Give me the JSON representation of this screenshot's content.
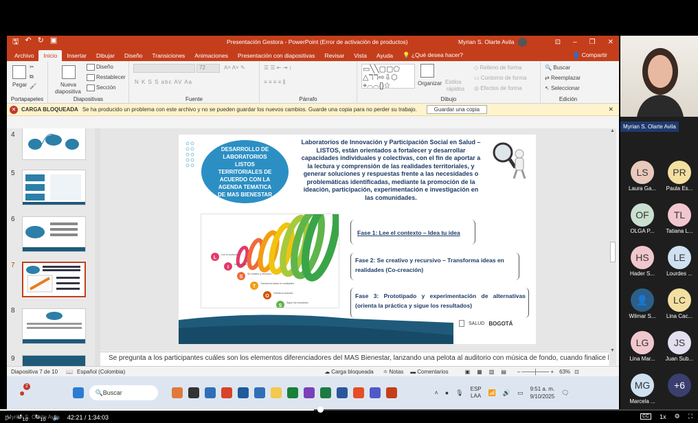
{
  "window": {
    "title": "Presentación Gestora - PowerPoint (Error de activación de productos)",
    "user": "Myrian S. Olarte Avila"
  },
  "tabs": [
    "Archivo",
    "Inicio",
    "Insertar",
    "Dibujar",
    "Diseño",
    "Transiciones",
    "Animaciones",
    "Presentación con diapositivas",
    "Revisar",
    "Vista",
    "Ayuda"
  ],
  "tellme": "¿Qué desea hacer?",
  "share": "Compartir",
  "ribbon": {
    "groups": [
      "Portapapeles",
      "Diapositivas",
      "Fuente",
      "Párrafo",
      "Dibujo",
      "Edición"
    ],
    "pegar": "Pegar",
    "nueva": "Nueva",
    "diapositiva": "diapositiva",
    "diseno": "Diseño",
    "restablecer": "Restablecer",
    "seccion": "Sección",
    "fontsize": "72",
    "fontbtns": "N  K  S  S  abc  AV  Aa",
    "organizar": "Organizar",
    "estilos": "Estilos",
    "rapidos": "rápidos",
    "relleno": "Relleno de forma",
    "contorno": "Contorno de forma",
    "efectos": "Efectos de forma",
    "buscar": "Buscar",
    "reemplazar": "Reemplazar",
    "seleccionar": "Seleccionar"
  },
  "infobar": {
    "title": "CARGA BLOQUEADA",
    "message": "Se ha producido un problema con este archivo y no se pueden guardar los nuevos cambios. Guarde una copia para no perder su trabajo.",
    "button": "Guardar una copia"
  },
  "thumbnails": [
    "4",
    "5",
    "6",
    "7",
    "8",
    "9"
  ],
  "slide": {
    "bubble": "DESARROLLO DE LABORATORIOS LISTOS TERRITORIALES DE ACUERDO CON LA AGENDA TEMATICA DE MAS BIENESTAR",
    "body": "Laboratorios de Innovación y Participación Social en Salud – LISTOS, están orientados a fortalecer y desarrollar capacidades individuales y colectivas, con el fin de aportar a la lectura y comprensión de las realidades territoriales, y generar soluciones y respuestas frente a las necesidades o problemáticas identificadas, mediante la promoción de la ideación, participación, experimentación e investigación en las comunidades.",
    "fase1": "Fase 1: Lee el contexto – Idea tu idea",
    "fase2": "Fase 2: Se creativo y recursivo – Transforma ideas en realidades (Co-creación)",
    "fase3": "Fase 3: Prototipado y experimentación de alternativas (orienta la práctica y sigue los resultados)",
    "spiral_letters": [
      "L",
      "I",
      "S",
      "T",
      "O",
      "S"
    ],
    "spiral_labels": [
      "Lee el contexto",
      "Idea tu idea",
      "Se creativo y recursivo",
      "Transforma ideas en realidades",
      "Orienta la práctica",
      "Sigue los resultados"
    ],
    "footer_logo": "BOGOTÁ",
    "footer_salud": "SALUD"
  },
  "notes": "Se pregunta a los participantes cuáles son los elementos diferenciadores del MAS Bienestar, lanzando una pelota al auditorio con música de fondo, cuando finalice la",
  "status": {
    "slide": "Diapositiva 7 de 10",
    "lang": "Español (Colombia)",
    "blocked": "Carga bloqueada",
    "notes": "Notas",
    "comments": "Comentarios",
    "zoom": "63%"
  },
  "taskbar": {
    "search": "Buscar",
    "lang1": "ESP",
    "lang2": "LAA",
    "time": "9:51 a. m.",
    "date": "9/10/2025",
    "badge": "2"
  },
  "participants": [
    {
      "initials": "LS",
      "name": "Laura Ga...",
      "color": "#e8c9bc"
    },
    {
      "initials": "PR",
      "name": "Paula Es...",
      "color": "#f3dfa0"
    },
    {
      "initials": "OF",
      "name": "OLGA P...",
      "color": "#c9dfcf"
    },
    {
      "initials": "TL",
      "name": "Tatiana L...",
      "color": "#f2c6cf"
    },
    {
      "initials": "HS",
      "name": "Hader S...",
      "color": "#f0c7cd"
    },
    {
      "initials": "LE",
      "name": "Lourdes ...",
      "color": "#cfe0f0"
    },
    {
      "initials": "",
      "name": "Wilmar S...",
      "color": "#2b5f8a"
    },
    {
      "initials": "LC",
      "name": "Lina Cac...",
      "color": "#f3dfa0"
    },
    {
      "initials": "LG",
      "name": "Lina Mar...",
      "color": "#f0c7cd"
    },
    {
      "initials": "JS",
      "name": "Juan Sub...",
      "color": "#e3dff0"
    },
    {
      "initials": "MG",
      "name": "Marcela ...",
      "color": "#cfe0f0"
    },
    {
      "initials": "+6",
      "name": "",
      "color": "#3a3f6e"
    }
  ],
  "presenter_label": "Myrian S. Olarte Avila",
  "video": {
    "time": "42:21 / 1:34:03",
    "speed": "1x",
    "ctrl1": "10",
    "ctrl2": "10",
    "cc": "CC"
  }
}
